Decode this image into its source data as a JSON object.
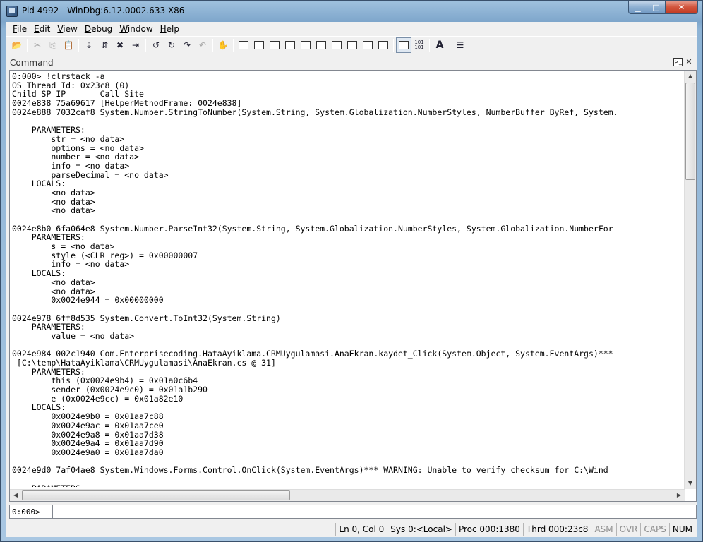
{
  "window": {
    "title": "Pid 4992 - WinDbg:6.12.0002.633 X86",
    "minimize": "▁",
    "maximize": "□",
    "close": "✕"
  },
  "menu": [
    {
      "u": "F",
      "rest": "ile"
    },
    {
      "u": "E",
      "rest": "dit"
    },
    {
      "u": "V",
      "rest": "iew"
    },
    {
      "u": "D",
      "rest": "ebug"
    },
    {
      "u": "W",
      "rest": "indow"
    },
    {
      "u": "H",
      "rest": "elp"
    }
  ],
  "toolbar": {
    "open_icon": "📂",
    "cut_icon": "✂",
    "copy_icon": "⎘",
    "paste_icon": "📋",
    "step_icons": [
      "⇣",
      "⇵",
      "✖",
      "⇥"
    ],
    "run_icons": [
      "↺",
      "↻",
      "↷",
      "↶"
    ],
    "break_icon": "✋",
    "hex_label": "101\n101",
    "font_icon": "A",
    "options_icon": "☰"
  },
  "command_pane": {
    "title": "Command",
    "prompt_glyph": ">_",
    "close_glyph": "✕",
    "output_lines": [
      "0:000> !clrstack -a",
      "OS Thread Id: 0x23c8 (0)",
      "Child SP IP       Call Site",
      "0024e838 75a69617 [HelperMethodFrame: 0024e838]",
      "0024e888 7032caf8 System.Number.StringToNumber(System.String, System.Globalization.NumberStyles, NumberBuffer ByRef, System.",
      "",
      "    PARAMETERS:",
      "        str = <no data>",
      "        options = <no data>",
      "        number = <no data>",
      "        info = <no data>",
      "        parseDecimal = <no data>",
      "    LOCALS:",
      "        <no data>",
      "        <no data>",
      "        <no data>",
      "",
      "0024e8b0 6fa064e8 System.Number.ParseInt32(System.String, System.Globalization.NumberStyles, System.Globalization.NumberFor",
      "    PARAMETERS:",
      "        s = <no data>",
      "        style (<CLR reg>) = 0x00000007",
      "        info = <no data>",
      "    LOCALS:",
      "        <no data>",
      "        <no data>",
      "        0x0024e944 = 0x00000000",
      "",
      "0024e978 6ff8d535 System.Convert.ToInt32(System.String)",
      "    PARAMETERS:",
      "        value = <no data>",
      "",
      "0024e984 002c1940 Com.Enterprisecoding.HataAyiklama.CRMUygulamasi.AnaEkran.kaydet_Click(System.Object, System.EventArgs)***",
      " [C:\\temp\\HataAyiklama\\CRMUygulamasi\\AnaEkran.cs @ 31]",
      "    PARAMETERS:",
      "        this (0x0024e9b4) = 0x01a0c6b4",
      "        sender (0x0024e9c0) = 0x01a1b290",
      "        e (0x0024e9cc) = 0x01a82e10",
      "    LOCALS:",
      "        0x0024e9b0 = 0x01aa7c88",
      "        0x0024e9ac = 0x01aa7ce0",
      "        0x0024e9a8 = 0x01aa7d38",
      "        0x0024e9a4 = 0x01aa7d90",
      "        0x0024e9a0 = 0x01aa7da0",
      "",
      "0024e9d0 7af04ae8 System.Windows.Forms.Control.OnClick(System.EventArgs)*** WARNING: Unable to verify checksum for C:\\Wind",
      "",
      "    PARAMETERS:"
    ],
    "input_prompt": "0:000>",
    "input_value": ""
  },
  "scrollbars": {
    "up": "▲",
    "down": "▼",
    "left": "◀",
    "right": "▶"
  },
  "statusbar": [
    {
      "text": "Ln 0, Col 0",
      "dim": false
    },
    {
      "text": "Sys 0:<Local>",
      "dim": false
    },
    {
      "text": "Proc 000:1380",
      "dim": false
    },
    {
      "text": "Thrd 000:23c8",
      "dim": false
    },
    {
      "text": "ASM",
      "dim": true
    },
    {
      "text": "OVR",
      "dim": true
    },
    {
      "text": "CAPS",
      "dim": true
    },
    {
      "text": "NUM",
      "dim": false
    }
  ]
}
